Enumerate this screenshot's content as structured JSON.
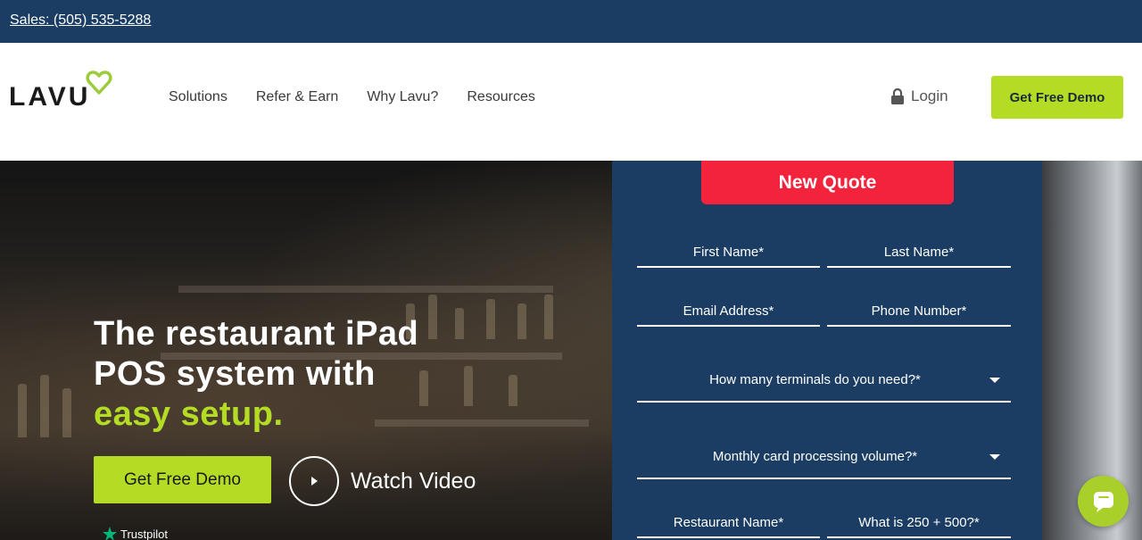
{
  "topbar": {
    "sales_link": "Sales: (505) 535-5288"
  },
  "header": {
    "logo_text": "LAVU",
    "nav": [
      "Solutions",
      "Refer & Earn",
      "Why Lavu?",
      "Resources"
    ],
    "login_label": "Login",
    "demo_label": "Get Free Demo"
  },
  "hero": {
    "headline_line1": "The restaurant iPad",
    "headline_line2": "POS system with",
    "headline_accent": "easy setup.",
    "demo_label": "Get Free Demo",
    "watch_label": "Watch Video",
    "trustpilot_label": "Trustpilot"
  },
  "form": {
    "quote_label": "New Quote",
    "first_name": "First Name*",
    "last_name": "Last Name*",
    "email": "Email Address*",
    "phone": "Phone Number*",
    "terminals": "How many terminals do you need?*",
    "volume": "Monthly card processing volume?*",
    "restaurant": "Restaurant Name*",
    "captcha": "What is 250 + 500?*"
  },
  "colors": {
    "navy": "#1b3d63",
    "lime": "#b5dc24",
    "red": "#f4233c"
  },
  "icons": [
    "lock-icon",
    "play-icon",
    "star-icon",
    "chat-icon",
    "heart-logo-icon"
  ]
}
